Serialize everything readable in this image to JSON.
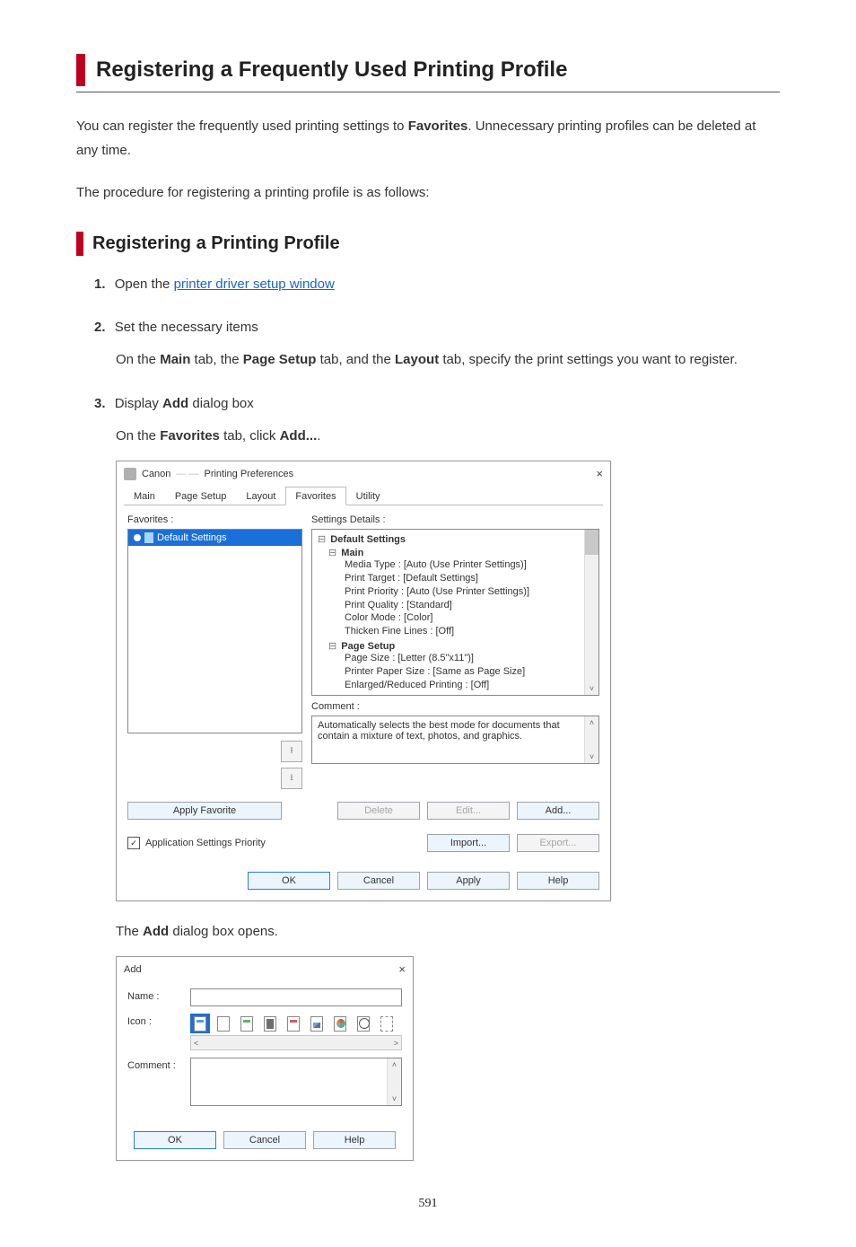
{
  "page_number": "591",
  "heading": "Registering a Frequently Used Printing Profile",
  "intro_pre": "You can register the frequently used printing settings to ",
  "intro_bold": "Favorites",
  "intro_post": ". Unnecessary printing profiles can be deleted at any time.",
  "intro2": "The procedure for registering a printing profile is as follows:",
  "subheading": "Registering a Printing Profile",
  "steps": {
    "s1": {
      "num": "1.",
      "lead": "Open the ",
      "link": "printer driver setup window"
    },
    "s2": {
      "num": "2.",
      "title": "Set the necessary items",
      "body_pre": "On the ",
      "b1": "Main",
      "body_mid1": " tab, the ",
      "b2": "Page Setup",
      "body_mid2": " tab, and the ",
      "b3": "Layout",
      "body_post": " tab, specify the print settings you want to register."
    },
    "s3": {
      "num": "3.",
      "title_pre": "Display ",
      "title_bold": "Add",
      "title_post": " dialog box",
      "body_pre": "On the ",
      "b1": "Favorites",
      "body_mid": " tab, click ",
      "b2": "Add...",
      "body_post": ".",
      "after_pre": "The ",
      "after_bold": "Add",
      "after_post": " dialog box opens."
    }
  },
  "pref_dialog": {
    "title_pre": "Canon ",
    "title_blur": "— —",
    "title_post": " Printing Preferences",
    "close": "×",
    "tabs": {
      "main": "Main",
      "page_setup": "Page Setup",
      "layout": "Layout",
      "favorites": "Favorites",
      "utility": "Utility"
    },
    "fav_label": "Favorites :",
    "fav_item": "Default Settings",
    "settings_label": "Settings Details :",
    "tree": {
      "root": "Default Settings",
      "main": "Main",
      "main_items": {
        "i1": "Media Type : [Auto (Use Printer Settings)]",
        "i2": "Print Target : [Default Settings]",
        "i3": "Print Priority : [Auto (Use Printer Settings)]",
        "i4": "Print Quality : [Standard]",
        "i5": "Color Mode : [Color]",
        "i6": "Thicken Fine Lines : [Off]"
      },
      "ps": "Page Setup",
      "ps_items": {
        "i1": "Page Size : [Letter (8.5\"x11\")]",
        "i2": "Printer Paper Size : [Same as Page Size]",
        "i3": "Enlarged/Reduced Printing : [Off]"
      }
    },
    "comment_label": "Comment :",
    "comment_text": "Automatically selects the best mode for documents that contain a mixture of text, photos, and graphics.",
    "apply_fav": "Apply Favorite",
    "delete": "Delete",
    "edit": "Edit...",
    "add": "Add...",
    "app_priority": "Application Settings Priority",
    "import": "Import...",
    "export": "Export...",
    "ok": "OK",
    "cancel": "Cancel",
    "apply": "Apply",
    "help": "Help"
  },
  "add_dialog": {
    "title": "Add",
    "close": "×",
    "name_label": "Name :",
    "icon_label": "Icon :",
    "comment_label": "Comment :",
    "ok": "OK",
    "cancel": "Cancel",
    "help": "Help",
    "scroll_left": "<",
    "scroll_right": ">"
  }
}
